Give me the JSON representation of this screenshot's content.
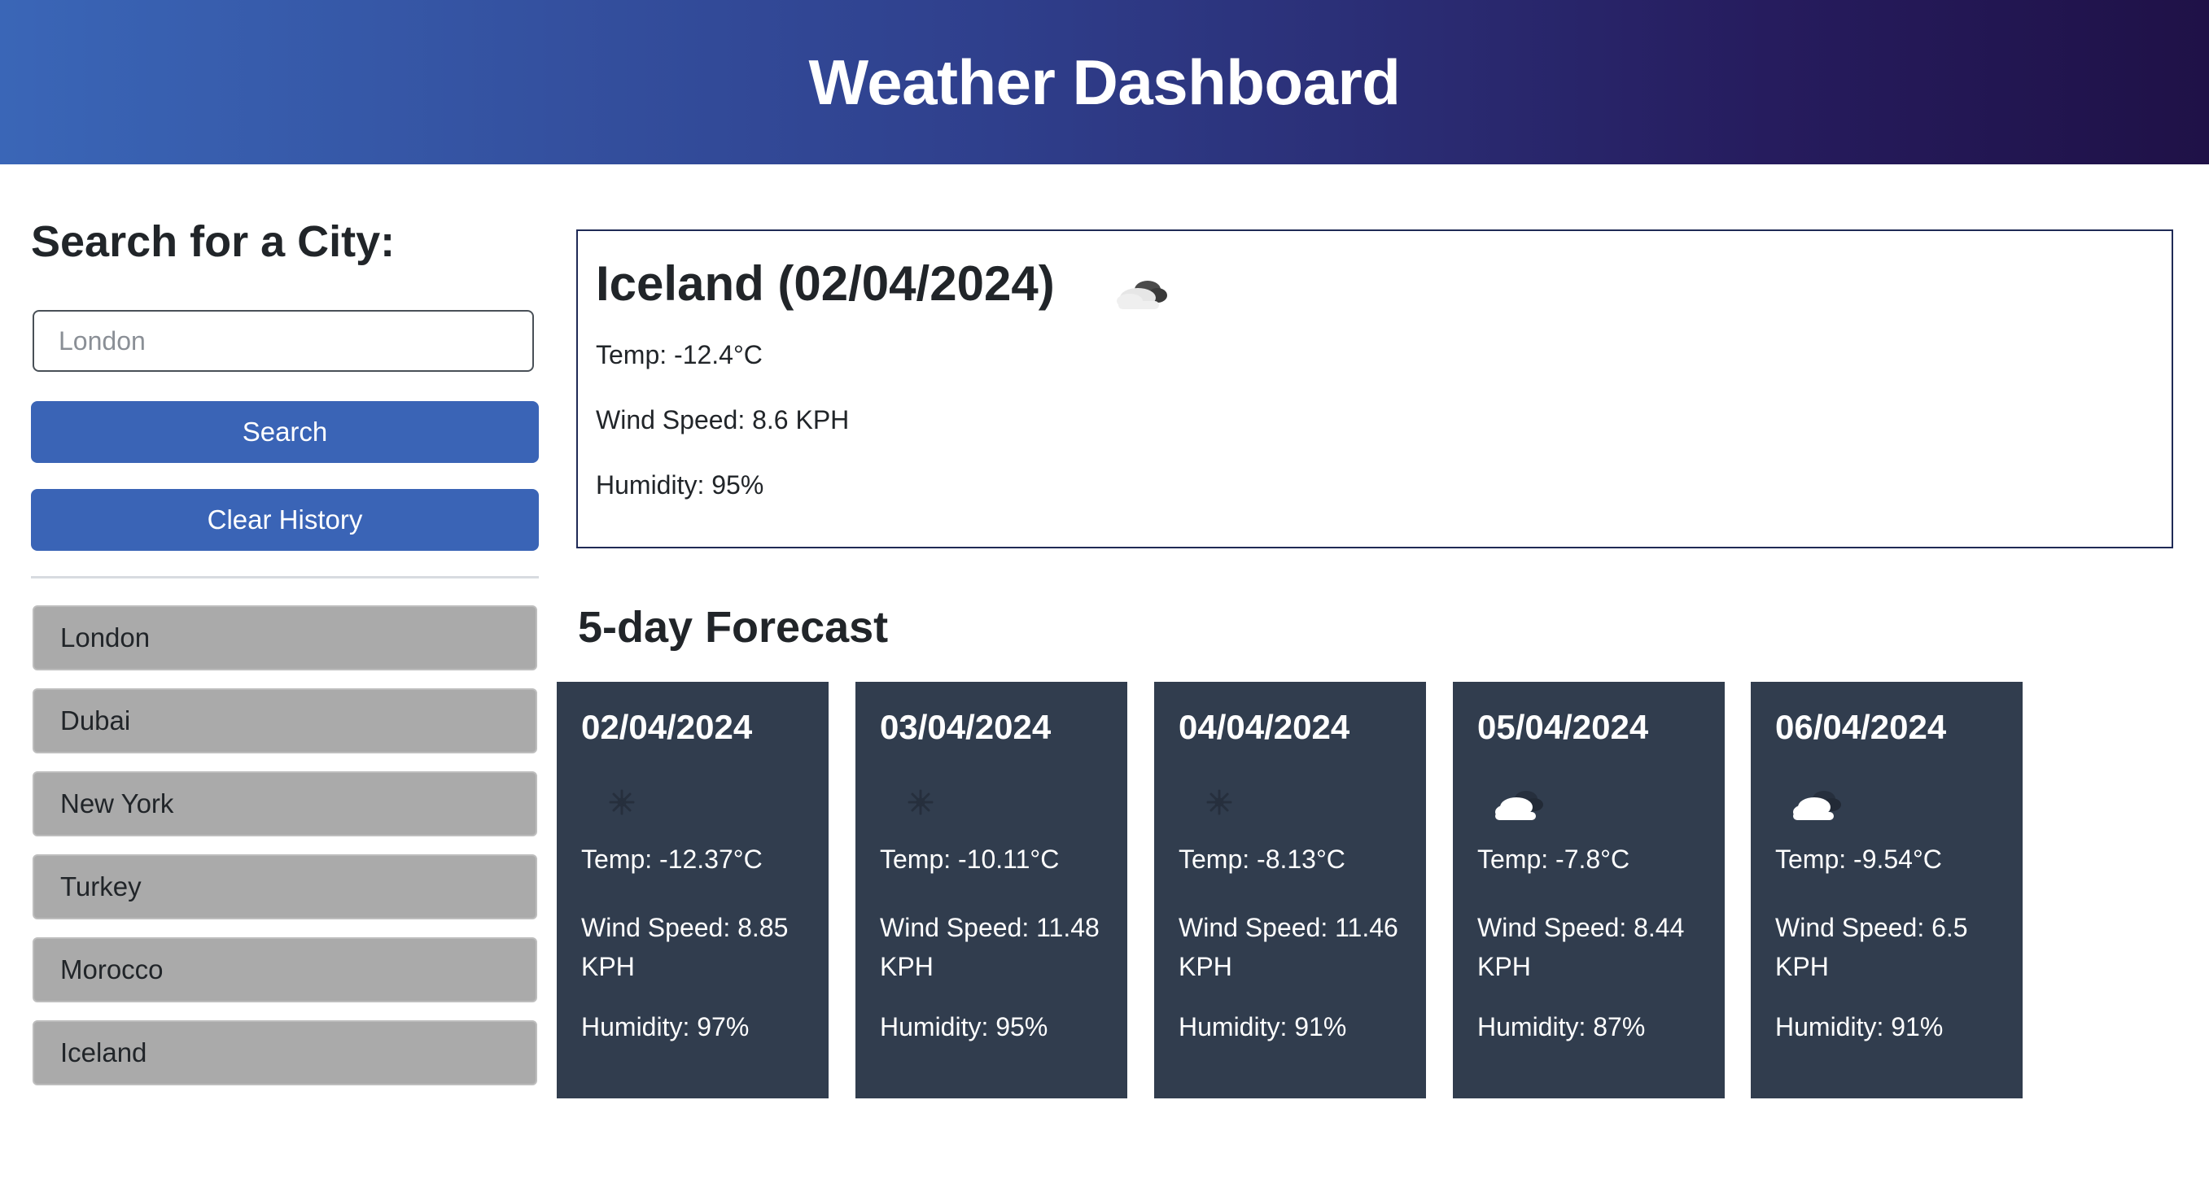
{
  "header": {
    "title": "Weather Dashboard"
  },
  "sidebar": {
    "heading": "Search for a City:",
    "search_input": {
      "placeholder": "London",
      "value": ""
    },
    "search_label": "Search",
    "clear_label": "Clear History",
    "history": [
      "London",
      "Dubai",
      "New York",
      "Turkey",
      "Morocco",
      "Iceland"
    ]
  },
  "current": {
    "title": "Iceland (02/04/2024)",
    "icon": "cloud-icon",
    "temp": "Temp: -12.4°C",
    "wind": "Wind Speed: 8.6 KPH",
    "humidity": "Humidity: 95%"
  },
  "forecast": {
    "title": "5-day Forecast",
    "days": [
      {
        "date": "02/04/2024",
        "icon": "snowflake-icon",
        "temp": "Temp: -12.37°C",
        "wind": "Wind Speed: 8.85 KPH",
        "humidity": "Humidity: 97%"
      },
      {
        "date": "03/04/2024",
        "icon": "snowflake-icon",
        "temp": "Temp: -10.11°C",
        "wind": "Wind Speed: 11.48 KPH",
        "humidity": "Humidity: 95%"
      },
      {
        "date": "04/04/2024",
        "icon": "snowflake-icon",
        "temp": "Temp: -8.13°C",
        "wind": "Wind Speed: 11.46 KPH",
        "humidity": "Humidity: 91%"
      },
      {
        "date": "05/04/2024",
        "icon": "cloud-icon",
        "temp": "Temp: -7.8°C",
        "wind": "Wind Speed: 8.44 KPH",
        "humidity": "Humidity: 87%"
      },
      {
        "date": "06/04/2024",
        "icon": "cloud-icon",
        "temp": "Temp: -9.54°C",
        "wind": "Wind Speed: 6.5 KPH",
        "humidity": "Humidity: 91%"
      }
    ]
  },
  "colors": {
    "accent": "#3a64b6",
    "card_bg": "#313d4e",
    "history_bg": "#aaaaaa",
    "header_start": "#3a66b7",
    "header_end": "#1f1147"
  }
}
